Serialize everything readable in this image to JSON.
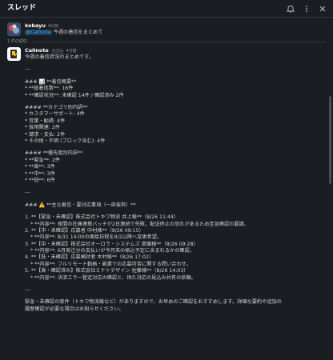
{
  "header": {
    "title": "スレッド"
  },
  "parent_message": {
    "user": "kobayu",
    "time": "4分前",
    "mention": "@Callnote",
    "text": " 今週の着信をまとめて"
  },
  "reply_divider": "1 件の返信",
  "reply": {
    "user": "Callnote",
    "app_tag": "アプリ",
    "time": "4分前",
    "lines": [
      {
        "t": "今週の着信状況のまとめです。"
      },
      {
        "gap": true
      },
      {
        "t": "---"
      },
      {
        "gap": true
      },
      {
        "t": "### 📊 **着信概要**"
      },
      {
        "t": "* **総着信数**: 16件"
      },
      {
        "t": "* **確認状況**: 未確認 14件 / 確認済み 2件"
      },
      {
        "gap": true
      },
      {
        "t": "#### **カテゴリ別内訳**"
      },
      {
        "t": "* カスタマーサポート: 4件"
      },
      {
        "t": "* 営業・勧誘: 4件"
      },
      {
        "t": "* 採用関連: 2件"
      },
      {
        "t": "* 請求・支払: 2件"
      },
      {
        "t": "* その他・不明 (ブロック含む): 4件"
      },
      {
        "gap": true
      },
      {
        "t": "#### **優先度別内訳**"
      },
      {
        "t": "* **緊急**: 2件"
      },
      {
        "t": "* **高**: 3件"
      },
      {
        "t": "* **中**: 3件"
      },
      {
        "t": "* **低**: 6件"
      },
      {
        "gap": true
      },
      {
        "t": "---"
      },
      {
        "gap": true
      },
      {
        "t": "### ⚠️ **主な着信・要対応事項（一部抜粋）**"
      },
      {
        "gap": true
      },
      {
        "t": "1. **【緊急・未確認】株式会社トキワ物流 井上様**（8/26 11:44）"
      },
      {
        "t": "* **内容**: 夜間の在庫連携バッチが2日連続で失敗。配送停止の恐れがあるため至急確認の要請。",
        "i": true
      },
      {
        "t": "2. **【中・未確認】応募者 中村様**（8/26 09:15）"
      },
      {
        "t": "* **内容**: 8/31 14:00の面接日程を9/2以降へ変更希望。",
        "i": true
      },
      {
        "t": "3. **【中・未確認】株式会社オーロラ・システムズ 斎藤様**（8/26 09:28）"
      },
      {
        "t": "* **内容**: 6月発注分の支払いが今月末の振込予定に含まれるかの確認。",
        "i": true
      },
      {
        "t": "4. **【低・未確認】応募検討者 木村様**（8/26 17:02）"
      },
      {
        "t": "* **内容**: フルリモート勤務・副業での応募可否に関する問い合わせ。",
        "i": true
      },
      {
        "t": "5. **【高・確認済み】株式会社ミナトデザイン 佐藤様**（8/26 14:03）"
      },
      {
        "t": "* **内容**: 決済エラー暫定対応の確認と、恒久対応の見込み共有の依頼。",
        "i": true
      },
      {
        "gap": true
      },
      {
        "t": "---"
      },
      {
        "gap": true
      },
      {
        "t": "緊急・未確認の案件（トキワ物流様など）がありますので、お早めのご確認をおすすめします。詳細な要約や追加の"
      },
      {
        "t": "履歴確認が必要な場合はお知らせください。"
      }
    ]
  }
}
